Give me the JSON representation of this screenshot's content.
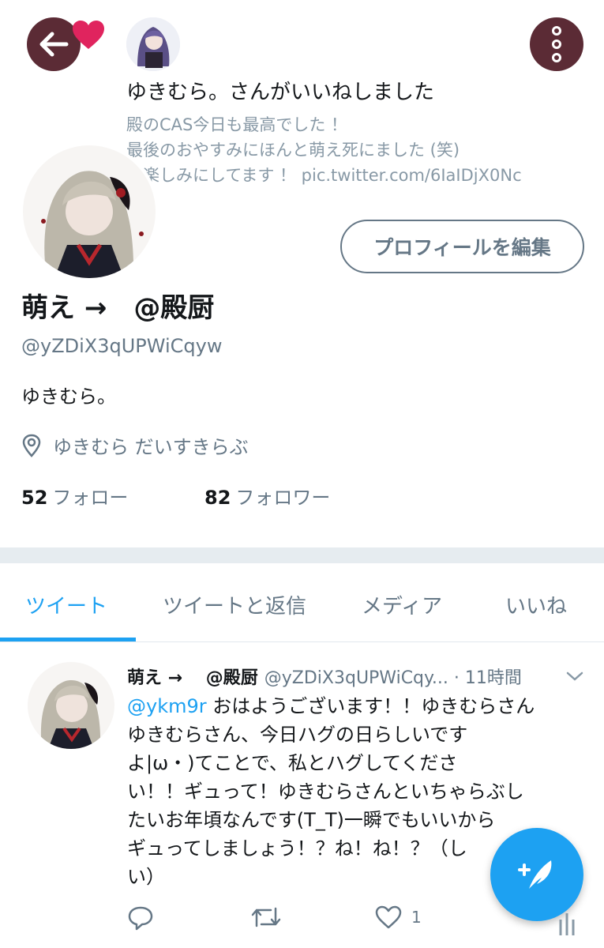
{
  "notification": {
    "title": "ゆきむら。さんがいいねしました",
    "tweet_line1": "殿のCAS今日も最高でした ！",
    "tweet_line2": "最後のおやすみにほんと萌え死にました (笑)",
    "tweet_line3": "も楽しみにしてます ！ pic.twitter.com/6IaIDjX0Nc"
  },
  "profile": {
    "edit_button": "プロフィールを編集",
    "display_name": "萌え →　@殿厨",
    "handle": "@yZDiX3qUPWiCqyw",
    "bio": "ゆきむら。",
    "location": "ゆきむら だいすきらぶ",
    "following_count": "52",
    "following_label": "フォロー",
    "followers_count": "82",
    "followers_label": "フォロワー"
  },
  "tabs": [
    {
      "label": "ツイート",
      "active": true
    },
    {
      "label": "ツイートと返信",
      "active": false
    },
    {
      "label": "メディア",
      "active": false
    },
    {
      "label": "いいね",
      "active": false
    }
  ],
  "tweet": {
    "name": "萌え → 　@殿厨",
    "meta": "@yZDiX3qUPWiCqy... · 11時間",
    "mention": "@ykm9r",
    "line1": " おはようございます！！ゆきむらさん",
    "line2": "ゆきむらさん、今日ハグの日らしいです",
    "line3": "よ|ω・)てことで、私とハグしてくださ",
    "line4": "い！！ギュって！ゆきむらさんといちゃらぶし",
    "line5": "たいお年頃なんです(T_T)一瞬でもいいから",
    "line6": "ギュってしましょう！？ね！ね！？（し",
    "line7": "い）",
    "like_count": "1"
  },
  "icons": {
    "back": "arrow-left-icon",
    "like": "heart-icon",
    "more": "more-vertical-icon",
    "location": "location-pin-icon",
    "reply": "reply-icon",
    "retweet": "retweet-icon",
    "compose": "compose-feather-icon"
  },
  "colors": {
    "accent": "#1da1f2",
    "heart": "#e0245e",
    "header_button": "#5b2b35",
    "muted": "#657786"
  }
}
